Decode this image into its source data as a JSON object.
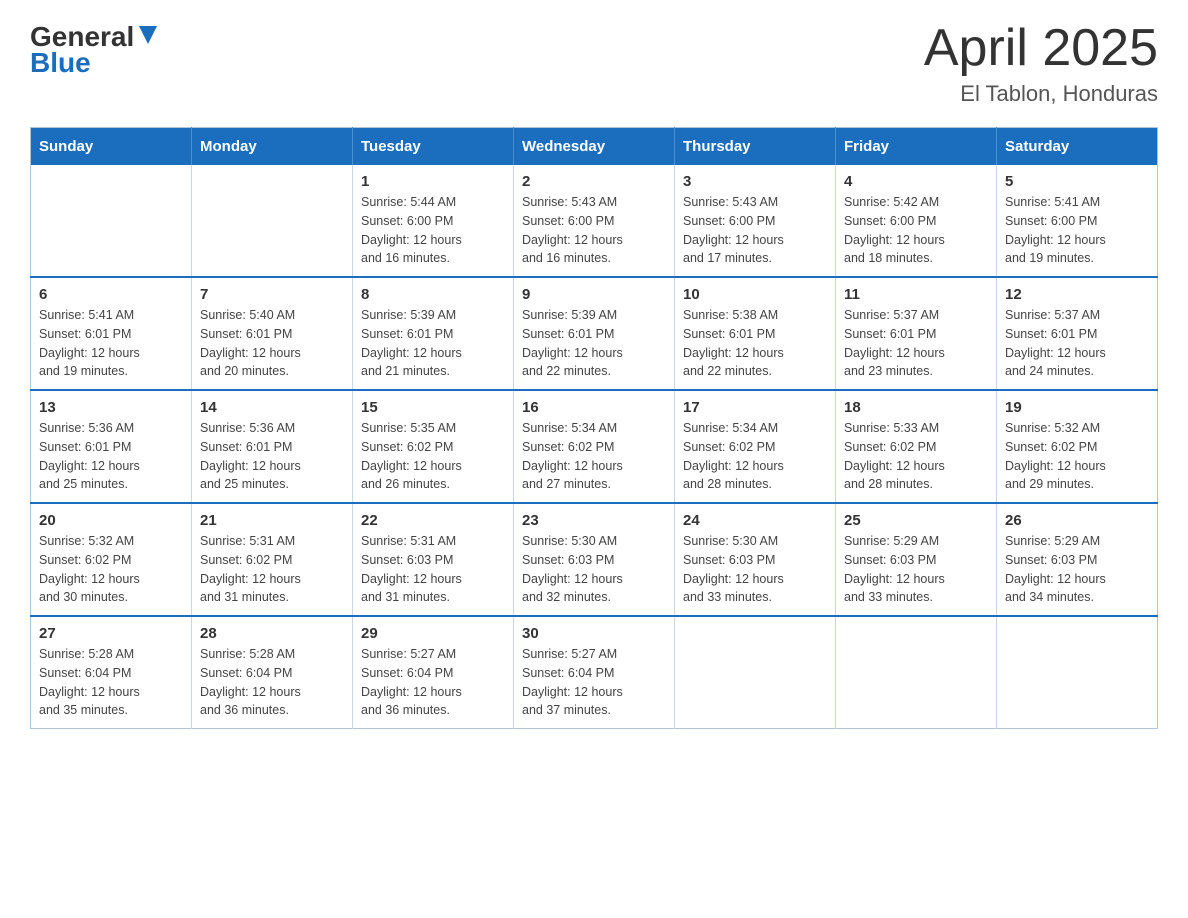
{
  "header": {
    "logo": {
      "line1": "General",
      "triangle": "▶",
      "line2": "Blue"
    },
    "title": "April 2025",
    "subtitle": "El Tablon, Honduras"
  },
  "calendar": {
    "days_of_week": [
      "Sunday",
      "Monday",
      "Tuesday",
      "Wednesday",
      "Thursday",
      "Friday",
      "Saturday"
    ],
    "weeks": [
      [
        {
          "day": "",
          "info": ""
        },
        {
          "day": "",
          "info": ""
        },
        {
          "day": "1",
          "info": "Sunrise: 5:44 AM\nSunset: 6:00 PM\nDaylight: 12 hours\nand 16 minutes."
        },
        {
          "day": "2",
          "info": "Sunrise: 5:43 AM\nSunset: 6:00 PM\nDaylight: 12 hours\nand 16 minutes."
        },
        {
          "day": "3",
          "info": "Sunrise: 5:43 AM\nSunset: 6:00 PM\nDaylight: 12 hours\nand 17 minutes."
        },
        {
          "day": "4",
          "info": "Sunrise: 5:42 AM\nSunset: 6:00 PM\nDaylight: 12 hours\nand 18 minutes."
        },
        {
          "day": "5",
          "info": "Sunrise: 5:41 AM\nSunset: 6:00 PM\nDaylight: 12 hours\nand 19 minutes."
        }
      ],
      [
        {
          "day": "6",
          "info": "Sunrise: 5:41 AM\nSunset: 6:01 PM\nDaylight: 12 hours\nand 19 minutes."
        },
        {
          "day": "7",
          "info": "Sunrise: 5:40 AM\nSunset: 6:01 PM\nDaylight: 12 hours\nand 20 minutes."
        },
        {
          "day": "8",
          "info": "Sunrise: 5:39 AM\nSunset: 6:01 PM\nDaylight: 12 hours\nand 21 minutes."
        },
        {
          "day": "9",
          "info": "Sunrise: 5:39 AM\nSunset: 6:01 PM\nDaylight: 12 hours\nand 22 minutes."
        },
        {
          "day": "10",
          "info": "Sunrise: 5:38 AM\nSunset: 6:01 PM\nDaylight: 12 hours\nand 22 minutes."
        },
        {
          "day": "11",
          "info": "Sunrise: 5:37 AM\nSunset: 6:01 PM\nDaylight: 12 hours\nand 23 minutes."
        },
        {
          "day": "12",
          "info": "Sunrise: 5:37 AM\nSunset: 6:01 PM\nDaylight: 12 hours\nand 24 minutes."
        }
      ],
      [
        {
          "day": "13",
          "info": "Sunrise: 5:36 AM\nSunset: 6:01 PM\nDaylight: 12 hours\nand 25 minutes."
        },
        {
          "day": "14",
          "info": "Sunrise: 5:36 AM\nSunset: 6:01 PM\nDaylight: 12 hours\nand 25 minutes."
        },
        {
          "day": "15",
          "info": "Sunrise: 5:35 AM\nSunset: 6:02 PM\nDaylight: 12 hours\nand 26 minutes."
        },
        {
          "day": "16",
          "info": "Sunrise: 5:34 AM\nSunset: 6:02 PM\nDaylight: 12 hours\nand 27 minutes."
        },
        {
          "day": "17",
          "info": "Sunrise: 5:34 AM\nSunset: 6:02 PM\nDaylight: 12 hours\nand 28 minutes."
        },
        {
          "day": "18",
          "info": "Sunrise: 5:33 AM\nSunset: 6:02 PM\nDaylight: 12 hours\nand 28 minutes."
        },
        {
          "day": "19",
          "info": "Sunrise: 5:32 AM\nSunset: 6:02 PM\nDaylight: 12 hours\nand 29 minutes."
        }
      ],
      [
        {
          "day": "20",
          "info": "Sunrise: 5:32 AM\nSunset: 6:02 PM\nDaylight: 12 hours\nand 30 minutes."
        },
        {
          "day": "21",
          "info": "Sunrise: 5:31 AM\nSunset: 6:02 PM\nDaylight: 12 hours\nand 31 minutes."
        },
        {
          "day": "22",
          "info": "Sunrise: 5:31 AM\nSunset: 6:03 PM\nDaylight: 12 hours\nand 31 minutes."
        },
        {
          "day": "23",
          "info": "Sunrise: 5:30 AM\nSunset: 6:03 PM\nDaylight: 12 hours\nand 32 minutes."
        },
        {
          "day": "24",
          "info": "Sunrise: 5:30 AM\nSunset: 6:03 PM\nDaylight: 12 hours\nand 33 minutes."
        },
        {
          "day": "25",
          "info": "Sunrise: 5:29 AM\nSunset: 6:03 PM\nDaylight: 12 hours\nand 33 minutes."
        },
        {
          "day": "26",
          "info": "Sunrise: 5:29 AM\nSunset: 6:03 PM\nDaylight: 12 hours\nand 34 minutes."
        }
      ],
      [
        {
          "day": "27",
          "info": "Sunrise: 5:28 AM\nSunset: 6:04 PM\nDaylight: 12 hours\nand 35 minutes."
        },
        {
          "day": "28",
          "info": "Sunrise: 5:28 AM\nSunset: 6:04 PM\nDaylight: 12 hours\nand 36 minutes."
        },
        {
          "day": "29",
          "info": "Sunrise: 5:27 AM\nSunset: 6:04 PM\nDaylight: 12 hours\nand 36 minutes."
        },
        {
          "day": "30",
          "info": "Sunrise: 5:27 AM\nSunset: 6:04 PM\nDaylight: 12 hours\nand 37 minutes."
        },
        {
          "day": "",
          "info": ""
        },
        {
          "day": "",
          "info": ""
        },
        {
          "day": "",
          "info": ""
        }
      ]
    ]
  }
}
